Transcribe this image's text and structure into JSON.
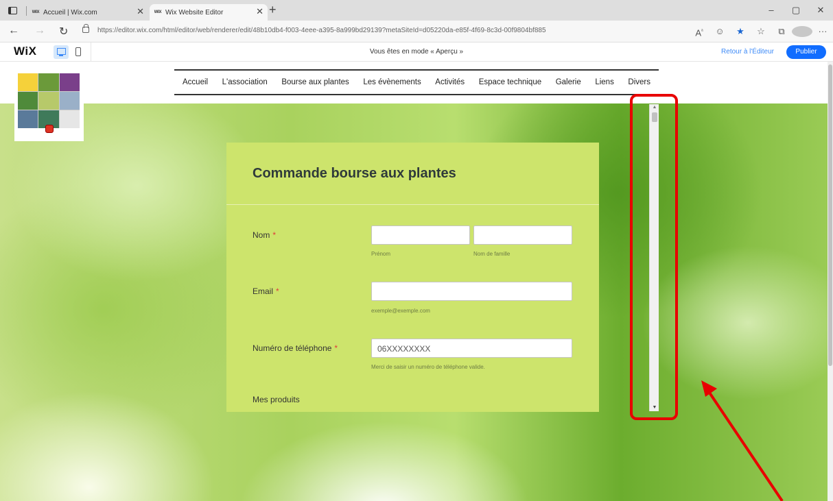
{
  "browser": {
    "tabs": [
      {
        "favicon": "WIX",
        "title": "Accueil | Wix.com",
        "active": false
      },
      {
        "favicon": "WIX",
        "title": "Wix Website Editor",
        "active": true
      }
    ],
    "url": "https://editor.wix.com/html/editor/web/renderer/edit/48b10db4-f003-4eee-a395-8a999bd29139?metaSiteId=d05220da-e85f-4f69-8c3d-00f9804bf885",
    "window_controls": {
      "minimize": "–",
      "restore": "▢",
      "close": "✕"
    },
    "icons": [
      "read-aloud-icon",
      "extensions-icon",
      "favorite-star-icon",
      "favorites-icon",
      "collections-icon",
      "profile-icon",
      "more-icon"
    ]
  },
  "wix_bar": {
    "logo": "WiX",
    "mode_text": "Vous êtes en mode « Aperçu »",
    "back_to_editor": "Retour à l'Éditeur",
    "publish": "Publier"
  },
  "site": {
    "nav": [
      "Accueil",
      "L'association",
      "Bourse aux plantes",
      "Les évènements",
      "Activités",
      "Espace technique",
      "Galerie",
      "Liens",
      "Divers"
    ],
    "colors": {
      "form_bg": "#cde46c",
      "annotation": "#e80000"
    }
  },
  "form": {
    "title": "Commande bourse aux plantes",
    "name_label": "Nom",
    "required_mark": "*",
    "first_name_hint": "Prénom",
    "last_name_hint": "Nom de famille",
    "email_label": "Email",
    "email_hint": "exemple@exemple.com",
    "phone_label": "Numéro de téléphone",
    "phone_placeholder": "06XXXXXXXX",
    "phone_hint": "Merci de saisir un numéro de téléphone valide.",
    "products_label": "Mes produits"
  }
}
